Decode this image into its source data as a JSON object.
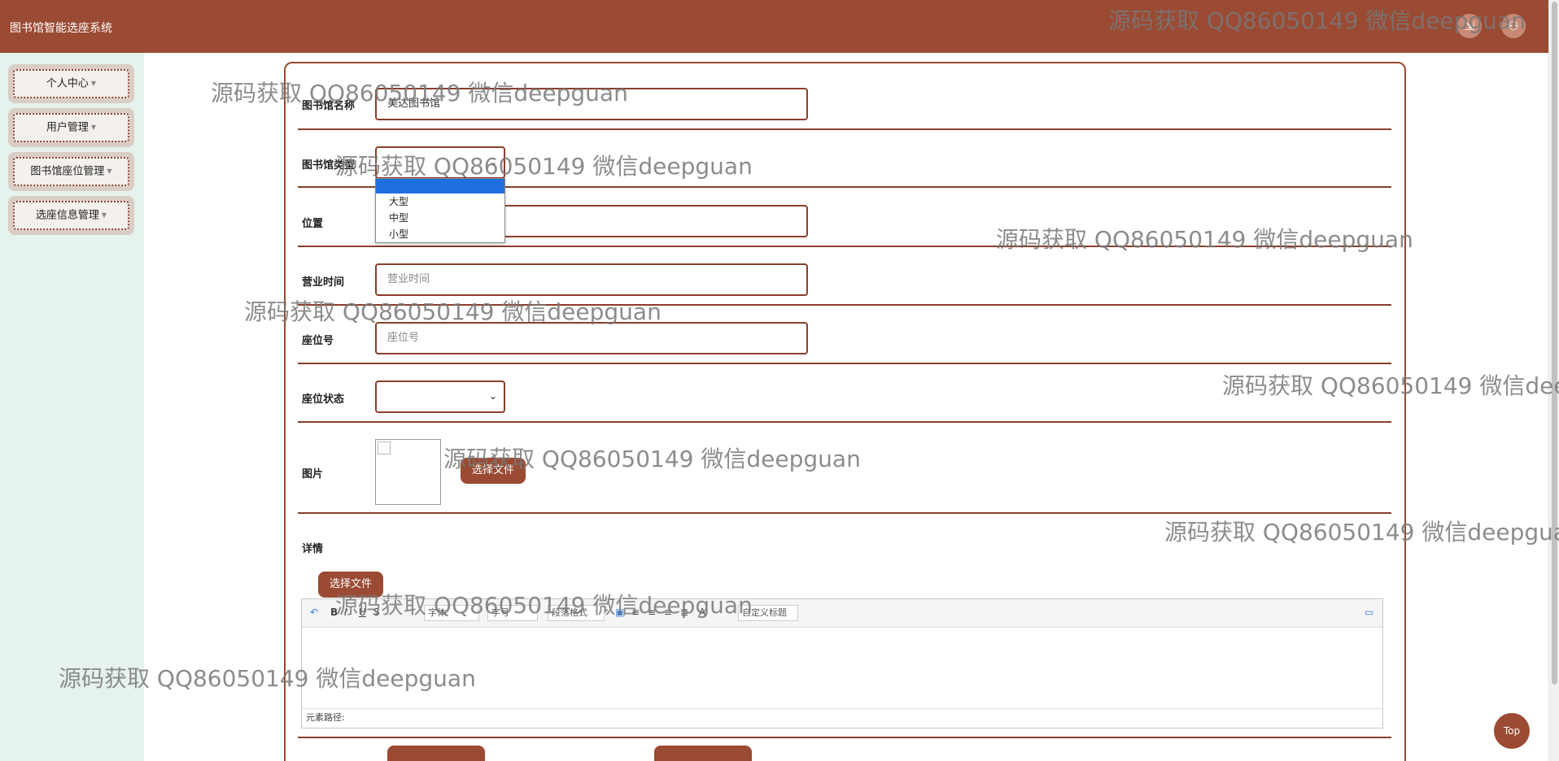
{
  "app": {
    "title": "图书馆智能选座系统"
  },
  "header": {
    "buttons": [
      {
        "icon": "exit-icon"
      },
      {
        "icon": "user-icon"
      }
    ]
  },
  "sidebar": {
    "items": [
      {
        "label": "个人中心"
      },
      {
        "label": "用户管理"
      },
      {
        "label": "图书馆座位管理"
      },
      {
        "label": "选座信息管理"
      }
    ]
  },
  "form": {
    "name": {
      "label": "图书馆名称",
      "value": "美达图书馆"
    },
    "type": {
      "label": "图书馆类型",
      "options": [
        "",
        "大型",
        "中型",
        "小型"
      ]
    },
    "location": {
      "label": "位置"
    },
    "hours": {
      "label": "营业时间",
      "placeholder": "营业时间"
    },
    "seat_no": {
      "label": "座位号",
      "placeholder": "座位号"
    },
    "seat_status": {
      "label": "座位状态"
    },
    "image": {
      "label": "图片",
      "button": "选择文件"
    },
    "detail": {
      "label": "详情",
      "button": "选择文件"
    }
  },
  "editor": {
    "font_family": "字体",
    "font_size": "字号",
    "paragraph": "段落格式",
    "custom_title": "自定义标题",
    "path_label": "元素路径:"
  },
  "top_button": "Top",
  "watermark": "源码获取 QQ86050149 微信deepguan",
  "colors": {
    "brand": "#9b4a33",
    "sidebar_bg": "#e6f3ec",
    "selection": "#1e6fe0"
  }
}
